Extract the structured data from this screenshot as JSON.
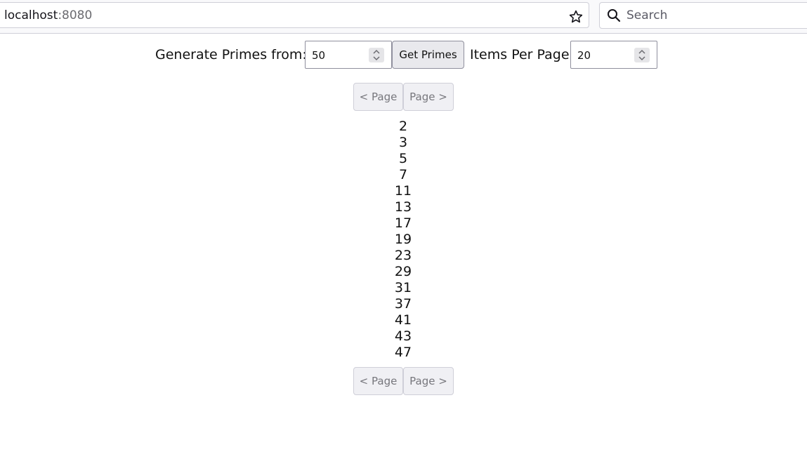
{
  "browser": {
    "url_host": "localhost",
    "url_port": ":8080",
    "search_placeholder": "Search"
  },
  "form": {
    "generate_label": "Generate Primes from:",
    "generate_value": "50",
    "get_primes_label": "Get Primes",
    "items_per_page_label": "Items Per Page",
    "items_per_page_value": "20"
  },
  "pager": {
    "prev_label": "< Page",
    "next_label": "Page >"
  },
  "primes": [
    "2",
    "3",
    "5",
    "7",
    "11",
    "13",
    "17",
    "19",
    "23",
    "29",
    "31",
    "37",
    "41",
    "43",
    "47"
  ]
}
